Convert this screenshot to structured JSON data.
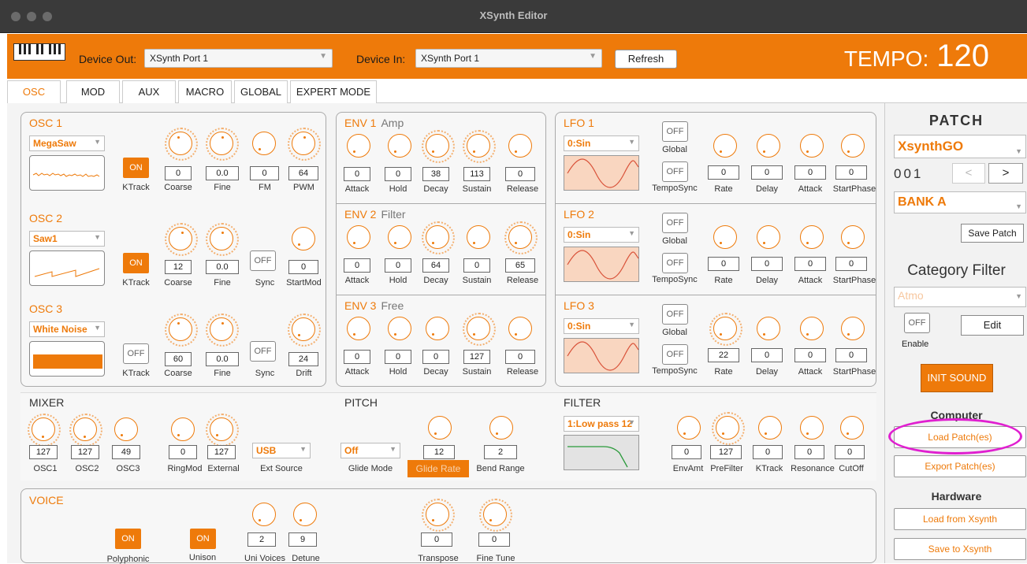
{
  "window": {
    "title": "XSynth Editor"
  },
  "topbar": {
    "device_out_label": "Device Out:",
    "device_out_value": "XSynth Port 1",
    "device_in_label": "Device In:",
    "device_in_value": "XSynth Port 1",
    "refresh_label": "Refresh",
    "tempo_label": "TEMPO:",
    "tempo_value": "120"
  },
  "tabs": [
    "OSC",
    "MOD",
    "AUX",
    "MACRO",
    "GLOBAL",
    "EXPERT MODE"
  ],
  "osc": [
    {
      "title": "OSC 1",
      "wave": "MegaSaw",
      "ktrack": "ON",
      "values": [
        "0",
        "0.0",
        "0",
        "64"
      ],
      "labels": [
        "KTrack",
        "Coarse",
        "Fine",
        "FM",
        "PWM"
      ]
    },
    {
      "title": "OSC 2",
      "wave": "Saw1",
      "ktrack": "ON",
      "sync": "OFF",
      "values": [
        "12",
        "0.0",
        "0"
      ],
      "labels": [
        "KTrack",
        "Coarse",
        "Fine",
        "Sync",
        "StartMod"
      ]
    },
    {
      "title": "OSC 3",
      "wave": "White Noise",
      "ktrack": "OFF",
      "sync": "OFF",
      "values": [
        "60",
        "0.0",
        "24"
      ],
      "labels": [
        "KTrack",
        "Coarse",
        "Fine",
        "Sync",
        "Drift"
      ]
    }
  ],
  "env": [
    {
      "title": "ENV 1",
      "sub": "Amp",
      "values": [
        "0",
        "0",
        "38",
        "113",
        "0"
      ]
    },
    {
      "title": "ENV 2",
      "sub": "Filter",
      "values": [
        "0",
        "0",
        "64",
        "0",
        "65"
      ]
    },
    {
      "title": "ENV 3",
      "sub": "Free",
      "values": [
        "0",
        "0",
        "0",
        "127",
        "0"
      ]
    }
  ],
  "env_labels": [
    "Attack",
    "Hold",
    "Decay",
    "Sustain",
    "Release"
  ],
  "lfo": [
    {
      "title": "LFO 1",
      "wave": "0:Sin",
      "global": "OFF",
      "temposync": "OFF",
      "values": [
        "0",
        "0",
        "0",
        "0"
      ]
    },
    {
      "title": "LFO 2",
      "wave": "0:Sin",
      "global": "OFF",
      "temposync": "OFF",
      "values": [
        "0",
        "0",
        "0",
        "0"
      ]
    },
    {
      "title": "LFO 3",
      "wave": "0:Sin",
      "global": "OFF",
      "temposync": "OFF",
      "values": [
        "22",
        "0",
        "0",
        "0"
      ]
    }
  ],
  "lfo_labels": {
    "global": "Global",
    "temposync": "TempoSync",
    "rate": "Rate",
    "delay": "Delay",
    "attack": "Attack",
    "startphase": "StartPhase"
  },
  "mixer": {
    "title": "MIXER",
    "values": [
      "127",
      "127",
      "49",
      "0",
      "127"
    ],
    "labels": [
      "OSC1",
      "OSC2",
      "OSC3",
      "RingMod",
      "External",
      "Ext Source"
    ],
    "ext_source": "USB"
  },
  "pitch": {
    "title": "PITCH",
    "glide_mode": "Off",
    "values": [
      "12",
      "2"
    ],
    "labels": [
      "Glide Mode",
      "Glide Rate",
      "Bend Range"
    ]
  },
  "filter": {
    "title": "FILTER",
    "type": "1:Low pass 12",
    "values": [
      "0",
      "127",
      "0",
      "0",
      "0"
    ],
    "labels": [
      "EnvAmt",
      "PreFilter",
      "KTrack",
      "Resonance",
      "CutOff"
    ]
  },
  "voice": {
    "title": "VOICE",
    "polyphonic": "ON",
    "unison": "ON",
    "values": [
      "2",
      "9",
      "0",
      "0"
    ],
    "labels": [
      "Polyphonic",
      "Unison",
      "Uni Voices",
      "Detune",
      "Transpose",
      "Fine Tune"
    ]
  },
  "patch": {
    "title": "PATCH",
    "name": "XsynthGO",
    "number": "001",
    "prev": "<",
    "next": ">",
    "bank": "BANK A",
    "save_label": "Save Patch",
    "category_title": "Category Filter",
    "category": "Atmo",
    "enable_state": "OFF",
    "enable_label": "Enable",
    "edit_label": "Edit",
    "init_label": "INIT SOUND",
    "computer_title": "Computer",
    "load_label": "Load Patch(es)",
    "export_label": "Export Patch(es)",
    "hardware_title": "Hardware",
    "load_hw_label": "Load from Xsynth",
    "save_hw_label": "Save to Xsynth"
  },
  "colors": {
    "accent": "#ee7a0a",
    "titlebar": "#3a3a3a",
    "highlight": "#e01fd0"
  }
}
